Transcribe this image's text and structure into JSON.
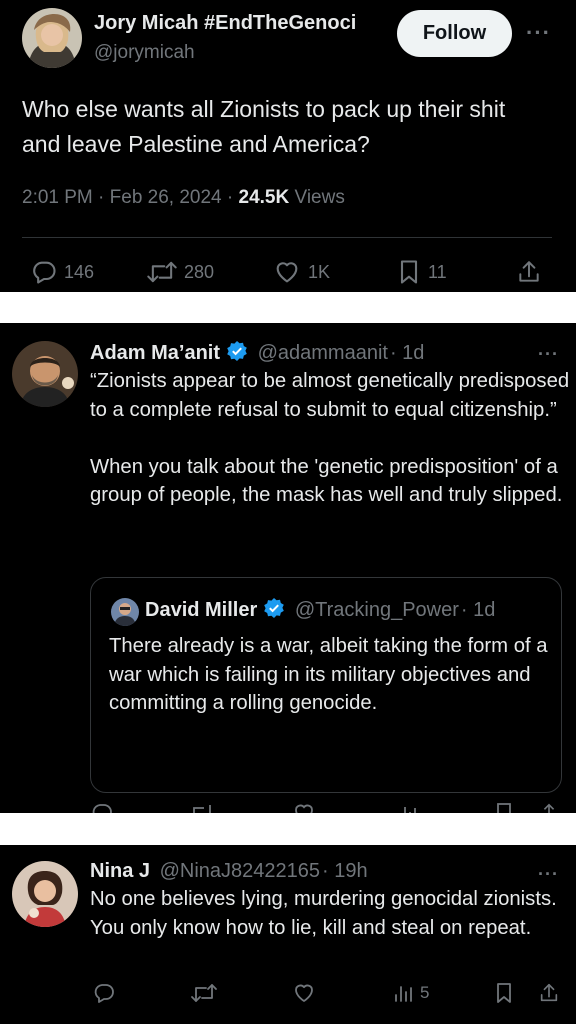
{
  "main_tweet": {
    "display_name": "Jory Micah #EndTheGenoci",
    "handle": "@jorymicah",
    "follow_label": "Follow",
    "text": "Who else wants all Zionists to pack up their shit and leave Palestine and America?",
    "timestamp": "2:01 PM · Feb 26, 2024 · ",
    "views_count": "24.5K",
    "views_label": " Views",
    "replies": "146",
    "retweets": "280",
    "likes": "1K",
    "bookmarks": "11"
  },
  "reply1": {
    "display_name": "Adam Ma’anit",
    "handle": "@adammaanit",
    "time": "· 1d",
    "text": "“Zionists appear to be almost genetically predisposed to a complete refusal to submit to equal citizenship.”\n\nWhen you talk about the 'genetic predisposition' of a group of people, the mask has well and truly slipped.",
    "verified_color": "#1d9bf0",
    "quoted": {
      "display_name": "David Miller",
      "handle": "@Tracking_Power",
      "time": "· 1d",
      "text": "There already is a war, albeit taking the form of a war which is failing in its military objectives and committing a rolling genocide."
    }
  },
  "reply2": {
    "display_name": "Nina J",
    "handle": "@NinaJ82422165",
    "time": "· 19h",
    "text": "No one believes lying, murdering genocidal zionists. You only know how to lie, kill and steal on repeat.",
    "views": "5"
  },
  "icons": [
    "more-icon",
    "reply-icon",
    "retweet-icon",
    "like-icon",
    "bookmark-icon",
    "share-icon",
    "views-icon",
    "verified-icon"
  ],
  "colors": {
    "background": "#000000",
    "text": "#e7e9ea",
    "muted": "#71767b",
    "accent": "#1d9bf0",
    "separator": "#ffffff"
  }
}
